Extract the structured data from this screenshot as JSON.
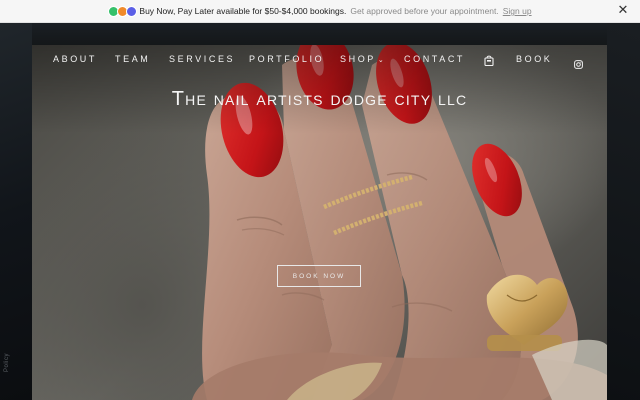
{
  "announcement": {
    "main_text": "Buy Now, Pay Later available for $50-$4,000 bookings.",
    "secondary_text": "Get approved before your appointment.",
    "link_text": "Sign up",
    "close_icon": "close-icon",
    "close_glyph": "✕"
  },
  "nav": {
    "items": [
      {
        "label": "ABOUT"
      },
      {
        "label": "TEAM"
      },
      {
        "label": "SERVICES"
      },
      {
        "label": "PORTFOLIO"
      },
      {
        "label": "SHOP"
      },
      {
        "label": "CONTACT"
      },
      {
        "label": "BOOK"
      }
    ],
    "shop_chevron": "⌄",
    "cart_icon": "shopping-bag-icon",
    "social_icon": "instagram-icon"
  },
  "hero": {
    "title": "The nail artists dodge city llc",
    "button_label": "BOOK NOW"
  },
  "side_text": "Policy",
  "colors": {
    "nail_red": "#c8171b",
    "announce_bg": "#f6f6f6",
    "page_bg": "#121416"
  }
}
